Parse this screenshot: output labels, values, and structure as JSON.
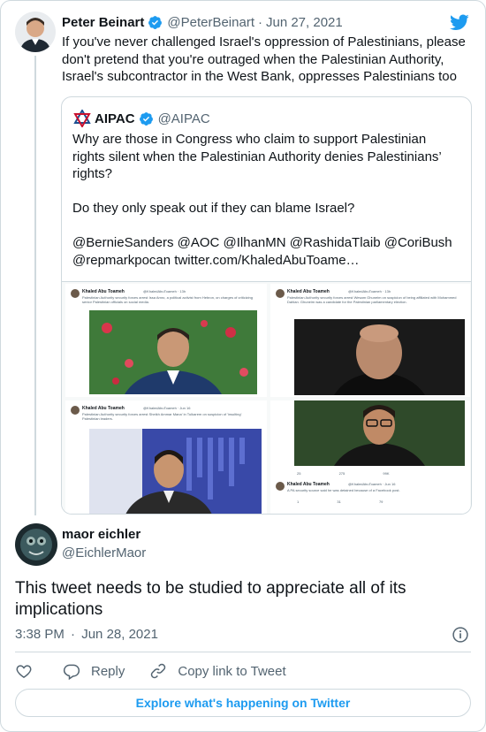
{
  "parent_tweet": {
    "author_name": "Peter Beinart",
    "handle": "@PeterBeinart",
    "separator": "·",
    "date": "Jun 27, 2021",
    "text": "If you've never challenged Israel's oppression of Palestinians, please don't pretend that you're outraged when the Palestinian Authority, Israel's subcontractor in the West Bank, oppresses Palestinians too",
    "verified_icon": "verified-badge-icon"
  },
  "quoted_tweet": {
    "author_name": "AIPAC",
    "handle": "@AIPAC",
    "text": "Why are those in Congress who claim to support Palestinian rights silent when the Palestinian Authority denies Palestinians’ rights?\n\nDo they only speak out if they can blame Israel?\n\n@BernieSanders @AOC @IlhanMN @RashidaTlaib @CoriBush @repmarkpocan twitter.com/KhaledAbuToame…",
    "media_cards": [
      {
        "author": "Khaled Abu Toameh",
        "meta": "@KhaledAbuToameh · 13h",
        "text": "Palestinian Authority security forces arrest Issa Amro, a political activist from Hebron, on charges of criticizing senior Palestinian officials on social media."
      },
      {
        "author": "Khaled Abu Toameh",
        "meta": "@KhaledAbuToameh · 13h",
        "text": "Palestinian Authority security forces arrest Wesam Ghuneim on suspicion of being affiliated with Mohammed Dahlan. Ghuneim was a candidate for the Palestinian parliamentary election."
      },
      {
        "author": "Khaled Abu Toameh",
        "meta": "@KhaledAbuToameh · Jun 16",
        "text": "Palestinian Authority security forces arrest Sheikh Ammar Mana' in Tulkarem on suspicion of 'insulting' Palestinian leaders."
      },
      {
        "author": "Khaled Abu Toameh",
        "meta": "@KhaledAbuToameh · Jun 16",
        "text": "A PA security source said he was detained because of a Facebook post."
      }
    ],
    "card_stats_top": [
      "25",
      "275",
      "99K"
    ],
    "card_stats_bottom": [
      "1",
      "31",
      "79"
    ]
  },
  "reply_tweet": {
    "author_name": "maor eichler",
    "handle": "@EichlerMaor",
    "text": "This tweet needs to be studied to appreciate all of its implications",
    "time": "3:38 PM",
    "separator": "·",
    "date": "Jun 28, 2021"
  },
  "actions": {
    "reply_label": "Reply",
    "copy_link_label": "Copy link to Tweet"
  },
  "footer": {
    "explore_label": "Explore what's happening on Twitter"
  },
  "colors": {
    "twitter_blue": "#1d9bf0",
    "text_primary": "#0f1419",
    "text_secondary": "#536471",
    "border": "#cfd9de"
  }
}
